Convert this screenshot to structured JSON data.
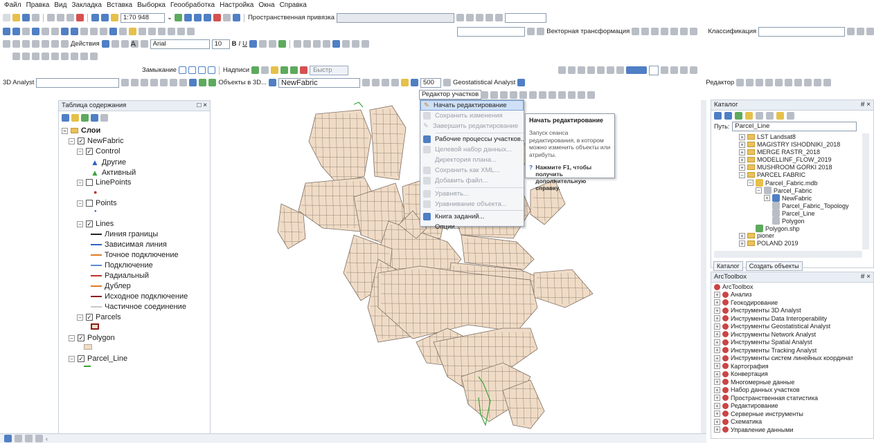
{
  "menu": [
    "Файл",
    "Правка",
    "Вид",
    "Закладка",
    "Вставка",
    "Выборка",
    "Геообработка",
    "Настройка",
    "Окна",
    "Справка"
  ],
  "toolbar": {
    "scale": "1:70 948",
    "spatial_ref": "Пространственная привязка",
    "vector_transform": "Векторная трансформация",
    "classification": "Классификация",
    "actions": "Действия",
    "font": "Arial",
    "font_size": "10",
    "bold": "B",
    "italic": "I",
    "underline": "U",
    "snapping": "Замыкание",
    "labels": "Надписи",
    "fast": "Быстр",
    "analyst3d": "3D Analyst",
    "objects3d": "Объекты в 3D...",
    "layer": "NewFabric",
    "distance": "500",
    "geostat": "Geostatistical Analyst",
    "editor": "Редактор",
    "parcel_editor": "Редактор участков"
  },
  "toc": {
    "title": "Таблица содержания",
    "close": "□ ×",
    "root": "Слои",
    "items": [
      {
        "label": "NewFabric"
      },
      {
        "label": "Control"
      },
      {
        "label": "Другие"
      },
      {
        "label": "Активный"
      },
      {
        "label": "LinePoints"
      },
      {
        "label": "Points"
      },
      {
        "label": "Lines"
      },
      {
        "label": "Линия границы"
      },
      {
        "label": "Зависимая линия"
      },
      {
        "label": "Точное подключение"
      },
      {
        "label": "Подключение"
      },
      {
        "label": "Радиальный"
      },
      {
        "label": "Дублер"
      },
      {
        "label": "Исходное подключение"
      },
      {
        "label": "Частичное соединение"
      },
      {
        "label": "Parcels"
      },
      {
        "label": "Polygon"
      },
      {
        "label": "Parcel_Line"
      }
    ]
  },
  "dropdown": {
    "items": [
      {
        "label": "Начать редактирование",
        "state": "highlight"
      },
      {
        "label": "Сохранить изменения",
        "state": "disabled"
      },
      {
        "label": "Завершить редактирование",
        "state": "disabled"
      },
      {
        "label": "Рабочие процессы участков...",
        "state": "enabled"
      },
      {
        "label": "Целевой набор данных...",
        "state": "disabled"
      },
      {
        "label": "Директория плана...",
        "state": "disabled"
      },
      {
        "label": "Сохранить как XML...",
        "state": "disabled"
      },
      {
        "label": "Добавить файл...",
        "state": "disabled"
      },
      {
        "label": "Уравнять...",
        "state": "disabled"
      },
      {
        "label": "Уравнивание объекта...",
        "state": "disabled"
      },
      {
        "label": "Книга заданий...",
        "state": "enabled"
      },
      {
        "label": "Опции...",
        "state": "enabled"
      }
    ]
  },
  "tooltip": {
    "title": "Начать редактирование",
    "body": "Запуск сеанса редактирования, в котором можно изменить объекты или атрибуты.",
    "help": "Нажмите F1, чтобы получить дополнительную справку."
  },
  "catalog": {
    "title": "Каталог",
    "path_label": "Путь:",
    "path": "Parcel_Line",
    "items": [
      "LST Landsat8",
      "MAGISTRY ISHODNIKI_2018",
      "MERGE RASTR_2018",
      "MODELLINF_FLOW_2019",
      "MUSHROOM GORKI 2018",
      "PARCEL FABRIC",
      "Parcel_Fabric.mdb",
      "Parcel_Fabric",
      "NewFabric",
      "Parcel_Fabric_Topology",
      "Parcel_Line",
      "Polygon",
      "Polygon.shp",
      "pioner",
      "POLAND 2019"
    ],
    "tab_catalog": "Каталог",
    "tab_create": "Создать объекты",
    "pin": "# ×"
  },
  "arctoolbox": {
    "title": "ArcToolbox",
    "pin": "# ×",
    "items": [
      "ArcToolbox",
      "Анализ",
      "Геокодирование",
      "Инструменты 3D Analyst",
      "Инструменты Data Interoperability",
      "Инструменты Geostatistical Analyst",
      "Инструменты Network Analyst",
      "Инструменты Spatial Analyst",
      "Инструменты Tracking Analyst",
      "Инструменты систем линейных координат",
      "Картография",
      "Конвертация",
      "Многомерные данные",
      "Набор данных участков",
      "Пространственная статистика",
      "Редактирование",
      "Серверные инструменты",
      "Схематика",
      "Управление данными"
    ]
  },
  "colors": {
    "parcel_fill": "#f0dcc6",
    "parcel_stroke": "#7d6e62",
    "green": "#3aa33a",
    "blue": "#2f63c4",
    "red": "#c0322b",
    "orange": "#e07b24",
    "darkred": "#8b1c1c"
  }
}
